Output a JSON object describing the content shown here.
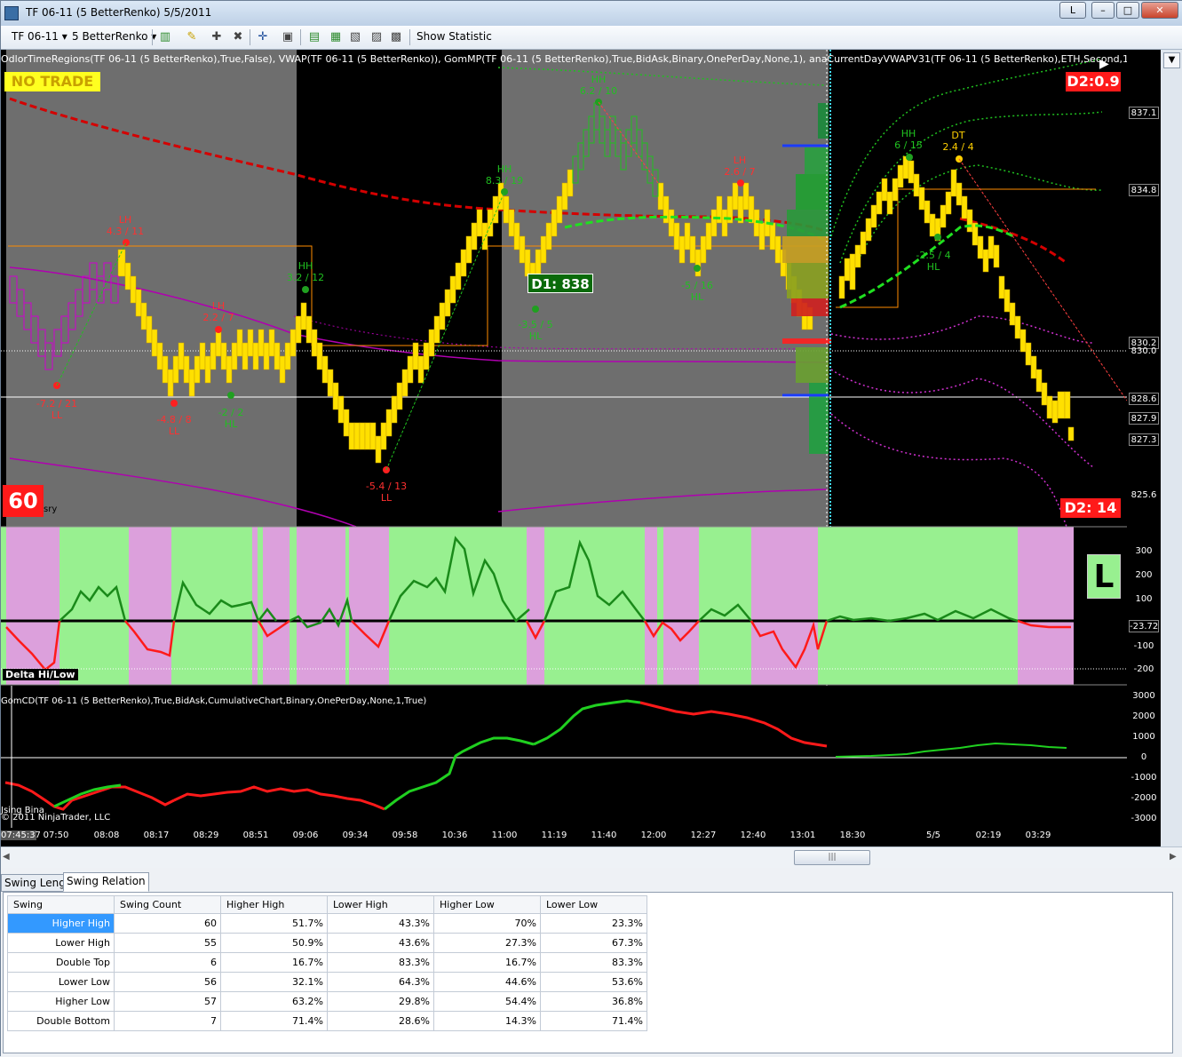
{
  "window": {
    "title": "TF 06-11 (5 BetterRenko)  5/5/2011",
    "btn_l": "L",
    "btn_min": "–",
    "btn_max": "□",
    "btn_close": "✕"
  },
  "toolbar": {
    "instrument": "TF 06-11",
    "bar_type": "5 BetterRenko",
    "show_statistic": "Show Statistic"
  },
  "chart": {
    "indicator_line": "OdlorTimeRegions(TF 06-11 (5 BetterRenko),True,False), VWAP(TF 06-11 (5 BetterRenko)), GomMP(TF 06-11 (5 BetterRenko),True,BidAsk,Binary,OnePerDay,None,1), anaCurrentDayVWAPV31(TF 06-11 (5 BetterRenko),ETH,Second,1), djdeviations(TF",
    "no_trade": "NO TRADE",
    "d2_top": "D2:0.9",
    "d2_bottom": "D2:  14",
    "d1_box": "D1: 838",
    "count_box": "60",
    "count_suffix": "sry",
    "delta_label": "Delta Hi/Low",
    "l_box": "L",
    "gomcd_label": "GomCD(TF 06-11 (5 BetterRenko),True,BidAsk,CumulativeChart,Binary,OnePerDay,None,1,True)",
    "copyright": "© 2011 NinjaTrader, LLC",
    "using_bina": "Jsing Bina",
    "price_labels": [
      "837.1",
      "834.8",
      "830.2",
      "830.0",
      "828.6",
      "827.9",
      "827.3",
      "825.6"
    ],
    "delta_labels": [
      "300",
      "200",
      "100",
      "-23.72",
      "-100",
      "-200"
    ],
    "gomcd_labels": [
      "3000",
      "2000",
      "1000",
      "0",
      "-1000",
      "-2000",
      "-3000"
    ],
    "time_labels": [
      "07:45:37",
      "07:50",
      "08:08",
      "08:17",
      "08:29",
      "08:51",
      "09:06",
      "09:34",
      "09:58",
      "10:36",
      "11:00",
      "11:19",
      "11:40",
      "12:00",
      "12:27",
      "12:40",
      "13:01",
      "18:30",
      "5/5",
      "02:19",
      "03:29"
    ],
    "swing_labels": [
      {
        "top": "LH",
        "bottom": "4.3 / 11"
      },
      {
        "top": "-7.2 / 21",
        "bottom": "LL"
      },
      {
        "top": "-4.8 / 8",
        "bottom": "LL"
      },
      {
        "top": "LH",
        "bottom": "2.2 / 7"
      },
      {
        "top": "-2 / 2",
        "bottom": "HL"
      },
      {
        "top": "HH",
        "bottom": "3.2 / 12"
      },
      {
        "top": "-5.4 / 13",
        "bottom": "LL"
      },
      {
        "top": "HH",
        "bottom": "8.3 / 19"
      },
      {
        "top": "-3.5 / 5",
        "bottom": "HL"
      },
      {
        "top": "HH",
        "bottom": "6.2 / 10"
      },
      {
        "top": "-5 / 16",
        "bottom": "HL"
      },
      {
        "top": "LH",
        "bottom": "2.6 / 7"
      },
      {
        "top": "HH",
        "bottom": "6 / 15"
      },
      {
        "top": "DT",
        "bottom": "2.4 / 4"
      },
      {
        "top": "-2.5 / 4",
        "bottom": "HL"
      }
    ]
  },
  "bottom": {
    "tabs": [
      "Swing Length",
      "Swing Relation"
    ],
    "columns": [
      "Swing",
      "Swing Count",
      "Higher High",
      "Lower High",
      "Higher Low",
      "Lower Low"
    ],
    "rows": [
      [
        "Higher High",
        "60",
        "51.7%",
        "43.3%",
        "70%",
        "23.3%"
      ],
      [
        "Lower High",
        "55",
        "50.9%",
        "43.6%",
        "27.3%",
        "67.3%"
      ],
      [
        "Double Top",
        "6",
        "16.7%",
        "83.3%",
        "16.7%",
        "83.3%"
      ],
      [
        "Lower Low",
        "56",
        "32.1%",
        "64.3%",
        "44.6%",
        "53.6%"
      ],
      [
        "Higher Low",
        "57",
        "63.2%",
        "29.8%",
        "54.4%",
        "36.8%"
      ],
      [
        "Double Bottom",
        "7",
        "71.4%",
        "28.6%",
        "14.3%",
        "71.4%"
      ]
    ]
  }
}
